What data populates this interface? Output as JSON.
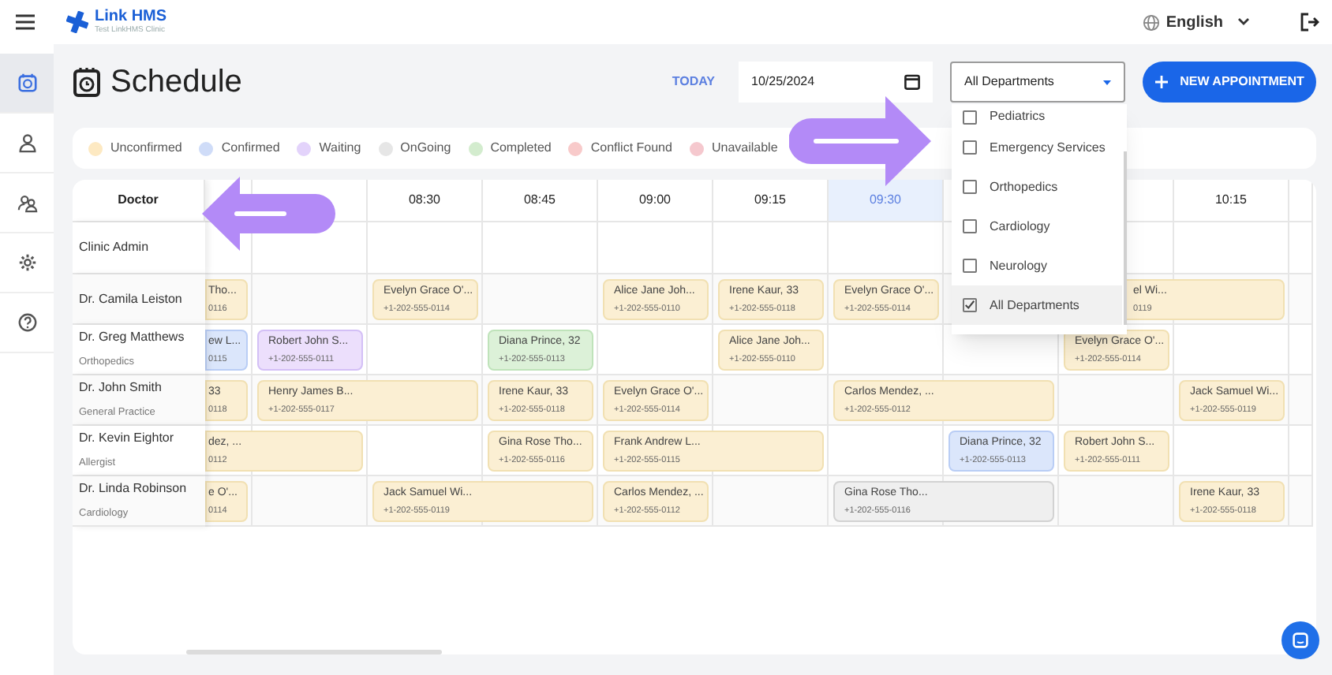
{
  "app": {
    "name": "Link HMS",
    "clinic": "Test LinkHMS Clinic"
  },
  "language": "English",
  "sidebar": {
    "items": [
      {
        "selected": true
      },
      {
        "selected": false
      },
      {
        "selected": false
      },
      {
        "selected": false
      },
      {
        "selected": false
      }
    ]
  },
  "page": {
    "title": "Schedule",
    "today_button": "TODAY",
    "date": "10/25/2024",
    "department_select": "All Departments",
    "new_button": "NEW APPOINTMENT"
  },
  "department_menu": [
    {
      "label": "Pediatrics",
      "checked": false,
      "selected": false
    },
    {
      "label": "Emergency Services",
      "checked": false,
      "selected": false
    },
    {
      "label": "Orthopedics",
      "checked": false,
      "selected": false
    },
    {
      "label": "Cardiology",
      "checked": false,
      "selected": false
    },
    {
      "label": "Neurology",
      "checked": false,
      "selected": false
    },
    {
      "label": "All Departments",
      "checked": true,
      "selected": true
    }
  ],
  "legend": [
    {
      "label": "Unconfirmed",
      "kind": "unconfirmed"
    },
    {
      "label": "Confirmed",
      "kind": "confirmed"
    },
    {
      "label": "Waiting",
      "kind": "waiting"
    },
    {
      "label": "OnGoing",
      "kind": "ongoing"
    },
    {
      "label": "Completed",
      "kind": "completed"
    },
    {
      "label": "Conflict Found",
      "kind": "conflict"
    },
    {
      "label": "Unavailable",
      "kind": "unavailable"
    }
  ],
  "schedule": {
    "doctor_header": "Doctor",
    "columns": [
      {
        "selected": false
      },
      {
        "selected": false
      },
      {
        "label": "08:30",
        "selected": false
      },
      {
        "label": "08:45",
        "selected": false
      },
      {
        "label": "09:00",
        "selected": false
      },
      {
        "label": "09:15",
        "selected": false
      },
      {
        "label": "09:30",
        "selected": true
      },
      {
        "selected": false
      },
      {
        "selected": false
      },
      {
        "label": "10:15",
        "selected": false
      },
      {
        "selected": false
      }
    ],
    "doctors": [
      {
        "name": "Clinic Admin",
        "slots": [
          {
            "kind": "free"
          },
          {
            "kind": "free"
          },
          {
            "kind": "free"
          },
          {
            "kind": "free"
          },
          {
            "kind": "free"
          },
          {
            "kind": "free"
          },
          {
            "kind": "free"
          },
          {
            "kind": "free"
          },
          {
            "kind": "free"
          },
          {
            "kind": "free"
          },
          {
            "kind": "free"
          }
        ]
      },
      {
        "name": "Dr. Camila Leiston",
        "slots": [
          {
            "kind": "unconfirmed",
            "name": "Tho...",
            "phone": "0116"
          },
          {
            "kind": "free"
          },
          {
            "kind": "unconfirmed",
            "name": "Evelyn Grace O'...",
            "phone": "+1-202-555-0114"
          },
          {
            "kind": "free"
          },
          {
            "kind": "unconfirmed",
            "name": "Alice Jane Joh...",
            "phone": "+1-202-555-0110"
          },
          {
            "kind": "unconfirmed",
            "name": "Irene Kaur, 33",
            "phone": "+1-202-555-0118"
          },
          {
            "kind": "unconfirmed",
            "name": "Evelyn Grace O'...",
            "phone": "+1-202-555-0114"
          },
          {
            "kind": "free"
          },
          {
            "kind": "unconfirmed",
            "name": "el Wi...",
            "phone": "0119"
          },
          {
            "kind": "continued"
          },
          {
            "kind": "free"
          }
        ]
      },
      {
        "name": "Dr. Greg Matthews",
        "specialty": "Orthopedics",
        "slots": [
          {
            "kind": "confirmed",
            "name": "ew L...",
            "phone": "0115"
          },
          {
            "kind": "waiting",
            "name": "Robert John S...",
            "phone": "+1-202-555-0111"
          },
          {
            "kind": "free"
          },
          {
            "kind": "completed",
            "name": "Diana Prince, 32",
            "phone": "+1-202-555-0113"
          },
          {
            "kind": "free"
          },
          {
            "kind": "unconfirmed",
            "name": "Alice Jane Joh...",
            "phone": "+1-202-555-0110"
          },
          {
            "kind": "free"
          },
          {
            "kind": "free"
          },
          {
            "kind": "unconfirmed",
            "name": "Evelyn Grace O'...",
            "phone": "+1-202-555-0114"
          },
          {
            "kind": "free"
          },
          {
            "kind": "free"
          }
        ]
      },
      {
        "name": "Dr. John Smith",
        "specialty": "General Practice",
        "slots": [
          {
            "kind": "unconfirmed",
            "name": "33",
            "phone": "0118"
          },
          {
            "kind": "unconfirmed",
            "name": "Henry James B...",
            "phone": "+1-202-555-0117"
          },
          {
            "kind": "continued"
          },
          {
            "kind": "unconfirmed",
            "name": "Irene Kaur, 33",
            "phone": "+1-202-555-0118"
          },
          {
            "kind": "unconfirmed",
            "name": "Evelyn Grace O'...",
            "phone": "+1-202-555-0114"
          },
          {
            "kind": "free"
          },
          {
            "kind": "unconfirmed",
            "name": "Carlos Mendez, ...",
            "phone": "+1-202-555-0112"
          },
          {
            "kind": "continued"
          },
          {
            "kind": "free"
          },
          {
            "kind": "unconfirmed",
            "name": "Jack Samuel Wi...",
            "phone": "+1-202-555-0119"
          },
          {
            "kind": "free"
          }
        ]
      },
      {
        "name": "Dr. Kevin Eightor",
        "specialty": "Allergist",
        "slots": [
          {
            "kind": "unconfirmed",
            "name": "dez, ...",
            "phone": "0112"
          },
          {
            "kind": "continued"
          },
          {
            "kind": "free"
          },
          {
            "kind": "unconfirmed",
            "name": "Gina Rose Tho...",
            "phone": "+1-202-555-0116"
          },
          {
            "kind": "unconfirmed",
            "name": "Frank Andrew L...",
            "phone": "+1-202-555-0115"
          },
          {
            "kind": "continued"
          },
          {
            "kind": "free"
          },
          {
            "kind": "confirmed",
            "name": "Diana Prince, 32",
            "phone": "+1-202-555-0113"
          },
          {
            "kind": "unconfirmed",
            "name": "Robert John S...",
            "phone": "+1-202-555-0111"
          },
          {
            "kind": "free"
          },
          {
            "kind": "free"
          }
        ]
      },
      {
        "name": "Dr. Linda Robinson",
        "specialty": "Cardiology",
        "slots": [
          {
            "kind": "unconfirmed",
            "name": "e O'...",
            "phone": "0114"
          },
          {
            "kind": "free"
          },
          {
            "kind": "unconfirmed",
            "name": "Jack Samuel Wi...",
            "phone": "+1-202-555-0119"
          },
          {
            "kind": "continued"
          },
          {
            "kind": "unconfirmed",
            "name": "Carlos Mendez, ...",
            "phone": "+1-202-555-0112"
          },
          {
            "kind": "free"
          },
          {
            "kind": "ongoing",
            "name": "Gina Rose Tho...",
            "phone": "+1-202-555-0116"
          },
          {
            "kind": "continued"
          },
          {
            "kind": "free"
          },
          {
            "kind": "unconfirmed",
            "name": "Irene Kaur, 33",
            "phone": "+1-202-555-0118"
          },
          {
            "kind": "free"
          }
        ]
      }
    ]
  }
}
